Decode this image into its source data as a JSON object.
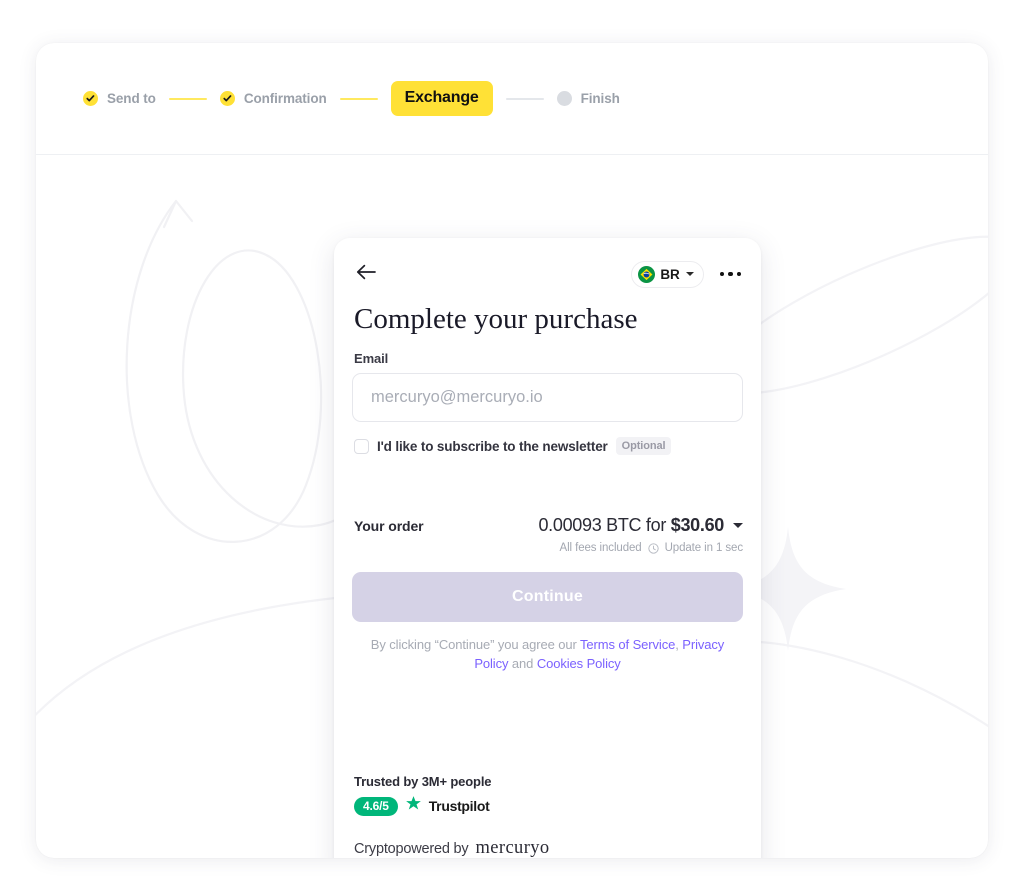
{
  "stepper": {
    "steps": [
      {
        "label": "Send to",
        "state": "done"
      },
      {
        "label": "Confirmation",
        "state": "done"
      },
      {
        "label": "Exchange",
        "state": "active"
      },
      {
        "label": "Finish",
        "state": "pending"
      }
    ]
  },
  "widget": {
    "back_icon": "arrow-left-icon",
    "country": {
      "code": "BR",
      "flag": "brazil-flag-icon"
    },
    "menu_icon": "more-options-icon",
    "title": "Complete your purchase",
    "email": {
      "label": "Email",
      "placeholder": "mercuryo@mercuryo.io",
      "value": ""
    },
    "newsletter": {
      "text": "I'd like to subscribe to the newsletter",
      "badge": "Optional",
      "checked": false
    },
    "order": {
      "label": "Your order",
      "crypto_amount": "0.00093 BTC for ",
      "fiat_amount": "$30.60",
      "fees_note": "All fees included",
      "update_note": "Update in 1 sec"
    },
    "continue_label": "Continue",
    "terms": {
      "prefix": "By clicking “Continue” you agree our ",
      "tos": "Terms of Service",
      "comma": ", ",
      "privacy": "Privacy Policy",
      "and": " and ",
      "cookies": "Cookies Policy"
    },
    "footer": {
      "trusted": "Trusted by 3M+ people",
      "score": "4.6/5",
      "trustpilot": "Trustpilot",
      "cryptopowered": "Cryptopowered by",
      "brand": "mercuryo"
    }
  },
  "colors": {
    "accent_yellow": "#FFE136",
    "button_lavender": "#D5D2E6",
    "link_purple": "#7B61FF",
    "trustpilot_green": "#00B67A"
  }
}
